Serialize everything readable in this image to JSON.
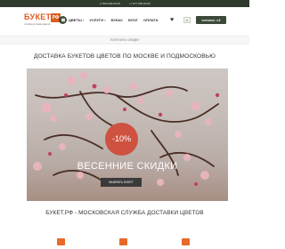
{
  "topbar": {
    "phone_1": "+7 800 000-00-00",
    "phone_2": "+7 977 000-00-00"
  },
  "logo": {
    "word": "БУКЕТ",
    "badge": "РФ",
    "tagline": "служба доставки цветов"
  },
  "menu": [
    {
      "label": "ЦВЕТЫ"
    },
    {
      "label": "УСЛУГИ"
    },
    {
      "label": "БУКАС"
    },
    {
      "label": "БЛОГ"
    },
    {
      "label": "ОПЛАТА"
    }
  ],
  "header": {
    "cart_label": "КОРЗИНА: 0 ₽"
  },
  "notice": "ПОЛУЧИТЬ СКИДКУ",
  "headline": "ДОСТАВКА БУКЕТОВ ЦВЕТОВ ПО МОСКВЕ И ПОДМОСКОВЬЮ",
  "hero": {
    "discount": "-10%",
    "title": "ВЕСЕННИЕ СКИДКИ",
    "button": "ВЫБРАТЬ БУКЕТ"
  },
  "subheadline": "БУКЕТ.РФ - МОСКОВСКАЯ СЛУЖБА ДОСТАВКИ ЦВЕТОВ",
  "colors": {
    "accent": "#e05a1e",
    "dark_green": "#3c4a39",
    "discount_red": "#cf5240",
    "feature_orange": "#e86a2a"
  }
}
